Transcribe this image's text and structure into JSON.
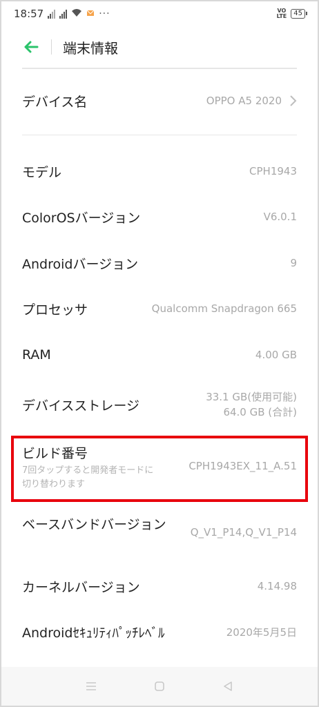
{
  "status_bar": {
    "time": "18:57",
    "battery": "45",
    "volte": "VoLTE"
  },
  "header": {
    "title": "端末情報"
  },
  "device_name": {
    "label": "デバイス名",
    "value": "OPPO A5 2020"
  },
  "rows": {
    "model": {
      "label": "モデル",
      "value": "CPH1943"
    },
    "coloros": {
      "label": "ColorOSバージョン",
      "value": "V6.0.1"
    },
    "android": {
      "label": "Androidバージョン",
      "value": "9"
    },
    "processor": {
      "label": "プロセッサ",
      "value": "Qualcomm Snapdragon 665"
    },
    "ram": {
      "label": "RAM",
      "value": "4.00 GB"
    },
    "storage": {
      "label": "デバイスストレージ",
      "value_line1": "33.1 GB(使用可能)",
      "value_line2": "64.0 GB (合計)"
    },
    "build": {
      "label": "ビルド番号",
      "sub": "7回タップすると開発者モードに切り替わります",
      "value": "CPH1943EX_11_A.51"
    },
    "baseband": {
      "label": "ベースバンドバージョン",
      "value": "Q_V1_P14,Q_V1_P14"
    },
    "kernel": {
      "label": "カーネルバージョン",
      "value": "4.14.98"
    },
    "security": {
      "label": "Androidｾｷｭﾘﾃｨﾊﾟｯﾁﾚﾍﾞﾙ",
      "value": "2020年5月5日"
    }
  },
  "colors": {
    "accent": "#2bc36b",
    "highlight": "#e8000c",
    "secondary_text": "#a8a8a8"
  },
  "icons": {
    "back": "arrow-left-icon",
    "chevron": "chevron-right-icon",
    "nav_menu": "menu-icon",
    "nav_home": "home-icon",
    "nav_back": "triangle-back-icon"
  }
}
